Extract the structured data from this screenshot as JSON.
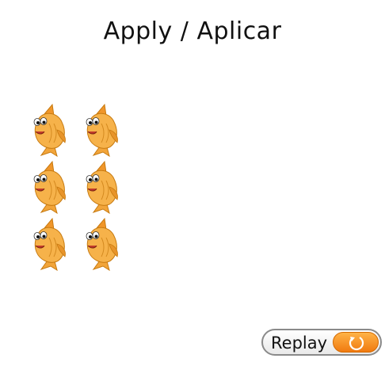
{
  "title": "Apply / Aplicar",
  "fish": {
    "count": 6,
    "icon": "goldfish-icon",
    "body_color": "#f4a93a"
  },
  "replay": {
    "label": "Replay",
    "icon": "replay-icon",
    "accent_color": "#f28a1e"
  }
}
